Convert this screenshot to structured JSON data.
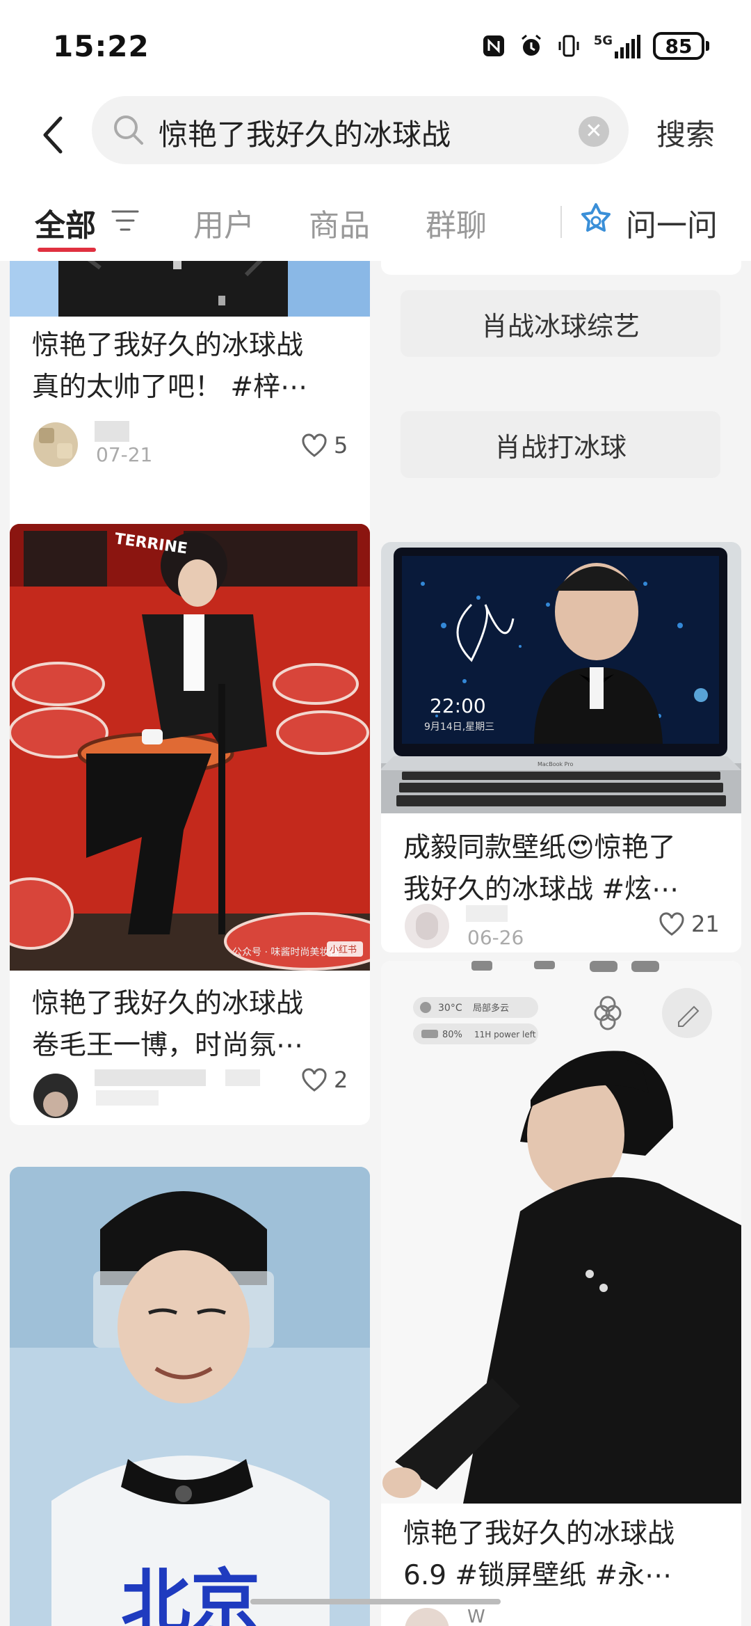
{
  "status": {
    "time": "15:22",
    "network": "5G",
    "battery": "85"
  },
  "search": {
    "query": "惊艳了我好久的冰球战",
    "button": "搜索"
  },
  "tabs": {
    "all": "全部",
    "users": "用户",
    "goods": "商品",
    "groups": "群聊",
    "ask": "问一问"
  },
  "cards": {
    "c1": {
      "title_l1": "惊艳了我好久的冰球战",
      "title_l2": "真的太帅了吧！ #梓⋯",
      "date": "07-21",
      "likes": "5"
    },
    "c2": {
      "title_l1": "惊艳了我好久的冰球战",
      "title_l2": "卷毛王一博，时尚氛⋯",
      "likes": "2",
      "img_sign": "TERRINE",
      "img_watermark": "公众号 · 味酱时尚美妆铺",
      "img_badge": "小红书"
    },
    "c4": {
      "title_l1": "成毅同款壁纸😍惊艳了",
      "title_l2": "我好久的冰球战 #炫⋯",
      "date": "06-26",
      "likes": "21",
      "img_clock": "22:00",
      "img_date": "9月14日,星期三",
      "img_brand": "MacBook Pro"
    },
    "c5": {
      "title_l1": "惊艳了我好久的冰球战",
      "title_l2": "6.9 #锁屏壁纸 #永⋯",
      "widget_weather_temp": "30°C",
      "widget_weather_desc": "局部多云",
      "widget_battery_pct": "80%",
      "widget_battery_desc": "11H power left",
      "author_initial": "W"
    },
    "c6": {
      "jersey_text": "北京"
    }
  },
  "suggestions": [
    "肖战冰球综艺",
    "肖战打冰球"
  ]
}
